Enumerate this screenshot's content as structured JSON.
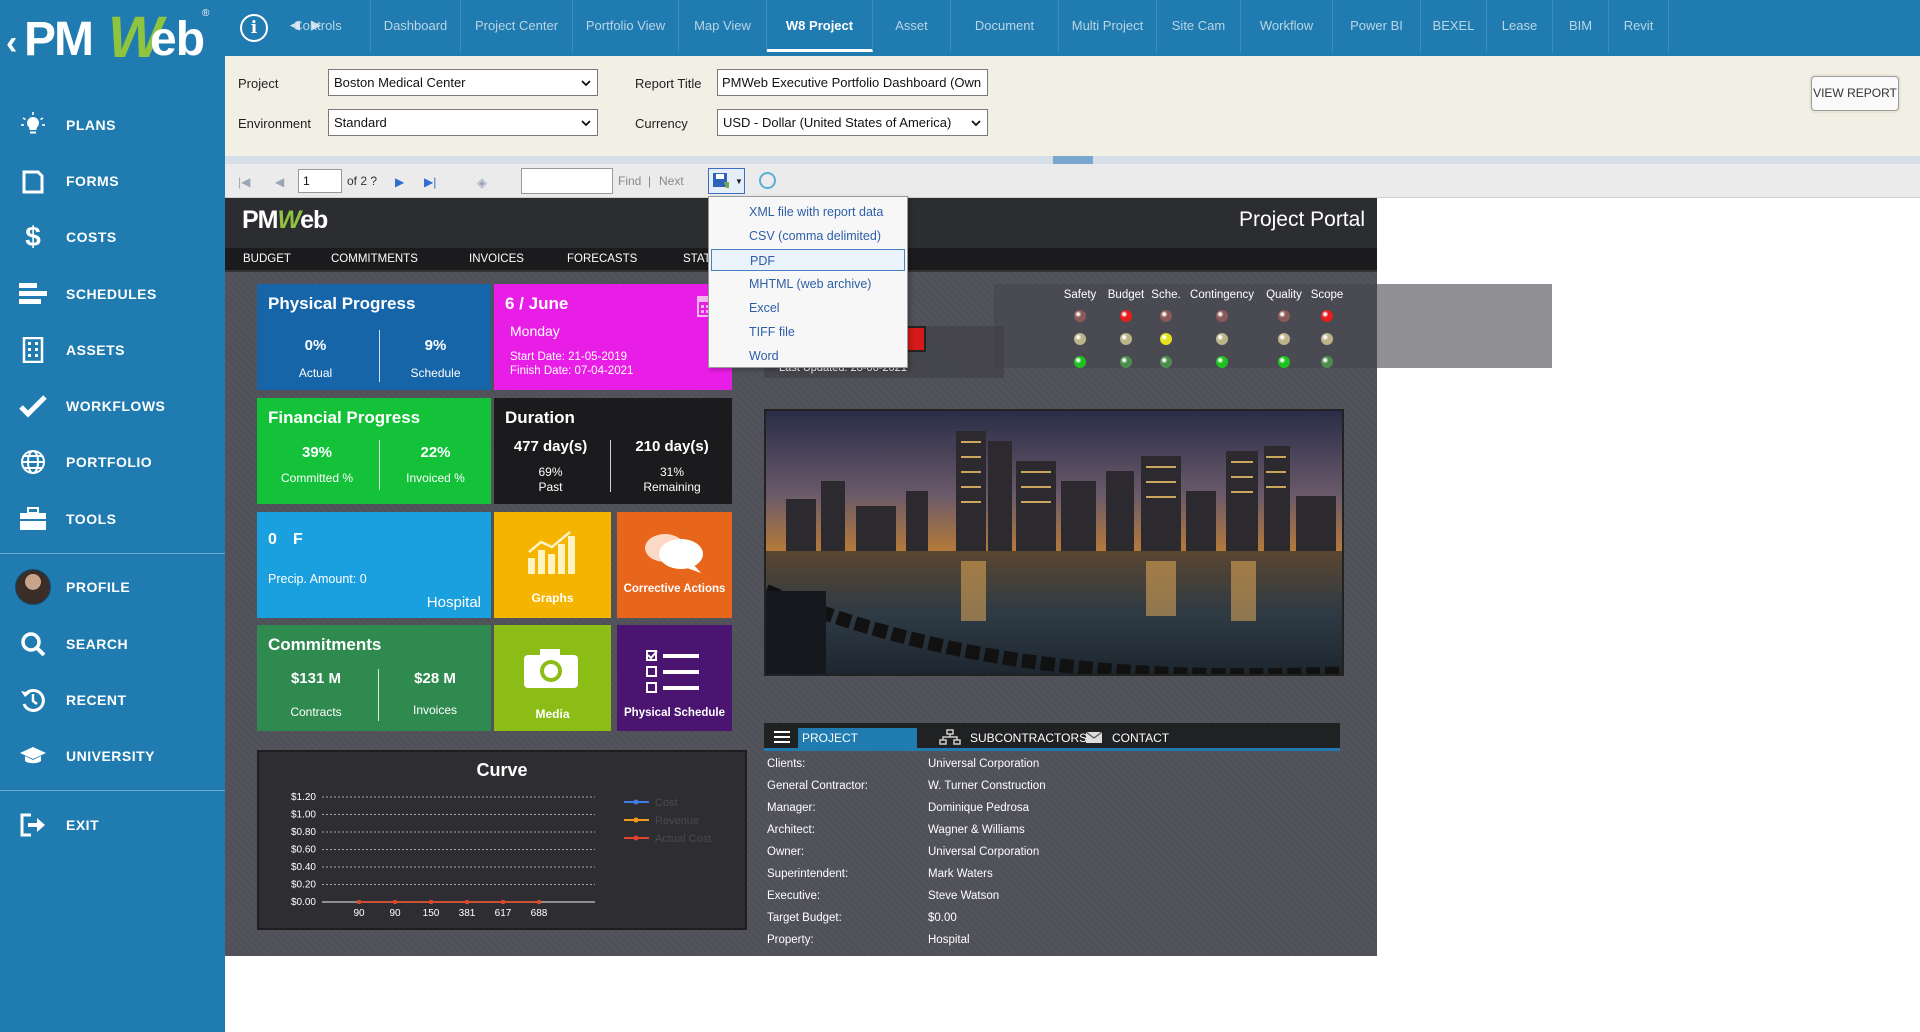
{
  "app": {
    "logo_text": "PMWeb"
  },
  "sidebar": {
    "items": [
      {
        "label": "PLANS",
        "icon": "lightbulb-icon"
      },
      {
        "label": "FORMS",
        "icon": "document-icon"
      },
      {
        "label": "COSTS",
        "icon": "dollar-icon"
      },
      {
        "label": "SCHEDULES",
        "icon": "gantt-icon"
      },
      {
        "label": "ASSETS",
        "icon": "building-icon"
      },
      {
        "label": "WORKFLOWS",
        "icon": "checkmark-icon"
      },
      {
        "label": "PORTFOLIO",
        "icon": "globe-icon"
      },
      {
        "label": "TOOLS",
        "icon": "briefcase-icon"
      },
      {
        "label": "PROFILE",
        "icon": "avatar"
      },
      {
        "label": "SEARCH",
        "icon": "search-icon"
      },
      {
        "label": "RECENT",
        "icon": "history-icon"
      },
      {
        "label": "UNIVERSITY",
        "icon": "graduation-cap-icon"
      },
      {
        "label": "EXIT",
        "icon": "exit-icon"
      }
    ]
  },
  "topnav": {
    "tabs": [
      "Controls",
      "Dashboard",
      "Project Center",
      "Portfolio View",
      "Map View",
      "W8 Project",
      "Asset",
      "Document",
      "Multi Project",
      "Site Cam",
      "Workflow",
      "Power BI",
      "BEXEL",
      "Lease",
      "BIM",
      "Revit"
    ],
    "active": "W8 Project"
  },
  "params": {
    "project_label": "Project",
    "project_value": "Boston Medical Center",
    "environment_label": "Environment",
    "environment_value": "Standard",
    "report_title_label": "Report Title",
    "report_title_value": "PMWeb Executive Portfolio Dashboard (Own",
    "currency_label": "Currency",
    "currency_value": "USD - Dollar (United States of America)",
    "view_report": "VIEW REPORT"
  },
  "toolbar": {
    "page_value": "1",
    "page_of": "of 2 ?",
    "find_label": "Find",
    "separator": "|",
    "next_label": "Next"
  },
  "export_menu": {
    "items": [
      "XML file with report data",
      "CSV (comma delimited)",
      "PDF",
      "MHTML (web archive)",
      "Excel",
      "TIFF file",
      "Word"
    ],
    "selected": "PDF"
  },
  "report": {
    "logo": {
      "pm": "PM",
      "w": "W",
      "eb": "eb"
    },
    "title": "Project Portal",
    "nav": [
      "BUDGET",
      "COMMITMENTS",
      "INVOICES",
      "FORECASTS",
      "STAT"
    ],
    "physical_progress": {
      "title": "Physical Progress",
      "actual_value": "0%",
      "actual_label": "Actual",
      "schedule_value": "9%",
      "schedule_label": "Schedule",
      "color": "#1565a8"
    },
    "date_tile": {
      "title": "6 / June",
      "day": "Monday",
      "start": "Start Date: 21-05-2019",
      "finish": "Finish Date: 07-04-2021",
      "color": "#e91ee6"
    },
    "financial_progress": {
      "title": "Financial Progress",
      "committed_value": "39%",
      "committed_label": "Committed %",
      "invoiced_value": "22%",
      "invoiced_label": "Invoiced %",
      "color": "#14c23a"
    },
    "duration": {
      "title": "Duration",
      "past_value": "477 day(s)",
      "past_pct": "69%",
      "past_label": "Past",
      "remaining_value": "210 day(s)",
      "remaining_pct": "31%",
      "remaining_label": "Remaining",
      "color": "#1b1b1d"
    },
    "weather": {
      "temp": "0",
      "unit": "F",
      "precip": "Precip. Amount: 0",
      "location": "Hospital",
      "color": "#1aa0de"
    },
    "graphs": {
      "label": "Graphs",
      "color": "#f4b400"
    },
    "corrective": {
      "label": "Corrective Actions",
      "color": "#e8661b"
    },
    "commitments": {
      "title": "Commitments",
      "contracts_value": "$131 M",
      "contracts_label": "Contracts",
      "invoices_value": "$28 M",
      "invoices_label": "Invoices",
      "color": "#2f8a4f"
    },
    "media": {
      "label": "Media",
      "color": "#8bbd16"
    },
    "physical_schedule": {
      "label": "Physical Schedule",
      "color": "#4a1470"
    },
    "last_updated": "Last Updated: 28-06-2021",
    "indicators": {
      "headers": [
        "Safety",
        "Budget",
        "Sche.",
        "Contingency",
        "Quality",
        "Scope"
      ],
      "top_colors": [
        "#8a5a58",
        "#e81c1c",
        "#8a5a58",
        "#8a5a58",
        "#8a5a58",
        "#e81c1c"
      ],
      "mid_colors": [
        "#bcb38a",
        "#bcb38a",
        "#e5e01c",
        "#bcb38a",
        "#bcb38a",
        "#bcb38a"
      ],
      "bot_colors": [
        "#1ec21e",
        "#4c8c4c",
        "#4c8c4c",
        "#1ec21e",
        "#1ec21e",
        "#4c8c4c"
      ]
    },
    "project_tabs": {
      "active": "PROJECT",
      "tab2": "SUBCONTRACTORS",
      "tab3": "CONTACT"
    },
    "project_info": [
      {
        "label": "Clients:",
        "value": "Universal Corporation"
      },
      {
        "label": "General Contractor:",
        "value": "W. Turner Construction"
      },
      {
        "label": "Manager:",
        "value": "Dominique Pedrosa"
      },
      {
        "label": "Architect:",
        "value": "Wagner & Williams"
      },
      {
        "label": "Owner:",
        "value": "Universal Corporation"
      },
      {
        "label": "Superintendent:",
        "value": "Mark Waters"
      },
      {
        "label": "Executive:",
        "value": "Steve Watson"
      },
      {
        "label": "Target Budget:",
        "value": "$0.00"
      },
      {
        "label": "Property:",
        "value": "Hospital"
      }
    ]
  },
  "chart_data": {
    "type": "line",
    "title": "Curve",
    "categories": [
      "90",
      "90",
      "150",
      "381",
      "617",
      "688"
    ],
    "series": [
      {
        "name": "Cost",
        "values": [
          0,
          0,
          0,
          0,
          0,
          0
        ],
        "color": "#3f7ee8"
      },
      {
        "name": "Revenue",
        "values": [
          0,
          0,
          0,
          0,
          0,
          0
        ],
        "color": "#f29b1c"
      },
      {
        "name": "Actual Cost",
        "values": [
          0,
          0,
          0,
          0,
          0,
          0
        ],
        "color": "#e0442a"
      }
    ],
    "yticks": [
      "$0.00",
      "$0.20",
      "$0.40",
      "$0.60",
      "$0.80",
      "$1.00",
      "$1.20"
    ],
    "ylim": [
      0,
      1.2
    ],
    "grid": true,
    "legend": "right"
  }
}
